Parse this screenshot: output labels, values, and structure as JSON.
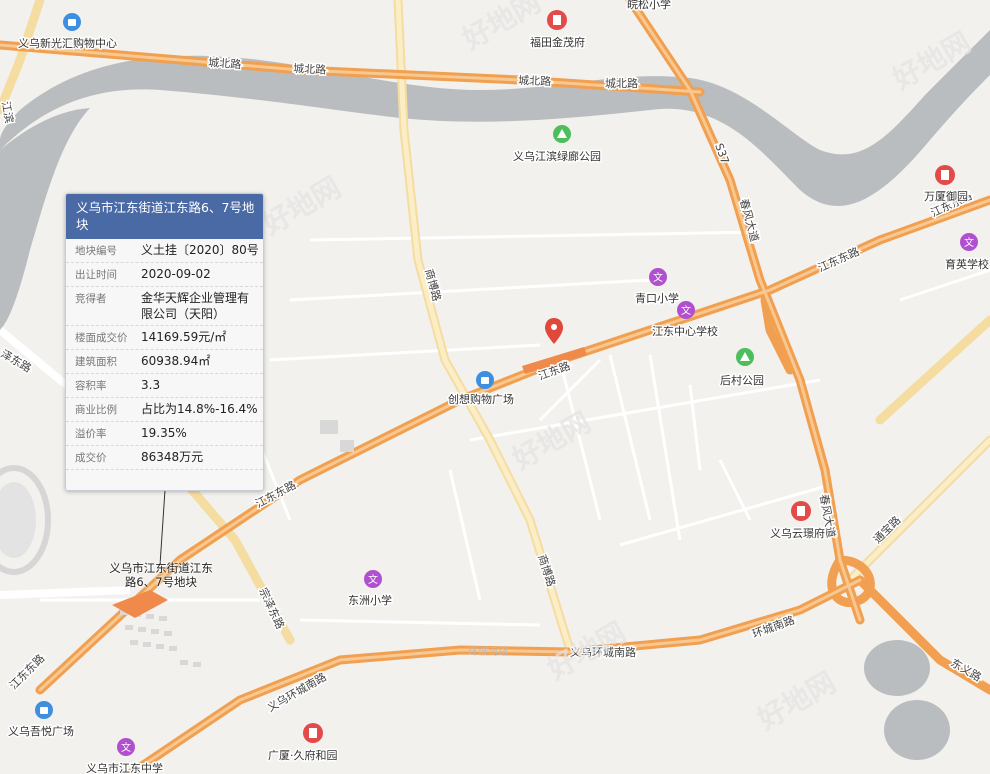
{
  "info_card": {
    "title": "义乌市江东街道江东路6、7号地块",
    "rows": [
      {
        "key": "地块编号",
        "value": "义土挂〔2020〕80号"
      },
      {
        "key": "出让时间",
        "value": "2020-09-02"
      },
      {
        "key": "竞得者",
        "value": "金华天辉企业管理有限公司（天阳）"
      },
      {
        "key": "楼面成交价",
        "value": "14169.59元/㎡"
      },
      {
        "key": "建筑面积",
        "value": "60938.94㎡"
      },
      {
        "key": "容积率",
        "value": "3.3"
      },
      {
        "key": "商业比例",
        "value": "占比为14.8%-16.4%"
      },
      {
        "key": "溢价率",
        "value": "19.35%"
      },
      {
        "key": "成交价",
        "value": "86348万元"
      }
    ]
  },
  "plot_label": "义乌市江东街道江东路6、7号地块",
  "roads": {
    "chengbei_1": "城北路",
    "chengbei_2": "城北路",
    "chengbei_3": "城北路",
    "chengbei_4": "城北路",
    "jiangdong_1": "江东东路",
    "jiangdong_2": "江东路",
    "jiangdong_3": "江东东路",
    "jiangdong_4": "江东东路",
    "shangbo_1": "商博路",
    "shangbo_2": "商博路",
    "zongze": "宗泽东路",
    "huancheng_1": "义乌环城南路",
    "huancheng_2": "环城南路",
    "huancheng_3": "义乌环城南路",
    "chunfeng_1": "春风大道",
    "chunfeng_2": "春风大道",
    "s37": "S37",
    "tongbao": "通宝路",
    "dongyi": "东义路",
    "jiangdong_east": "江东东路",
    "ze_left": "泽东路",
    "jiang_left": "江滨"
  },
  "pois": [
    {
      "name": "义乌新光汇购物中心",
      "icon": "shopping-icon",
      "color": "#3f8fe0"
    },
    {
      "name": "福田金茂府",
      "icon": "residence-icon",
      "color": "#e34a4a"
    },
    {
      "name": "皖松小学",
      "icon": "none",
      "color": ""
    },
    {
      "name": "义乌江滨绿廊公园",
      "icon": "park-icon",
      "color": "#4cbf5c"
    },
    {
      "name": "万厦御园",
      "icon": "residence-icon",
      "color": "#e34a4a"
    },
    {
      "name": "育英学校",
      "icon": "school-icon",
      "color": "#b050d0"
    },
    {
      "name": "青口小学",
      "icon": "school-icon",
      "color": "#b050d0"
    },
    {
      "name": "江东中心学校",
      "icon": "school-icon",
      "color": "#b050d0"
    },
    {
      "name": "后村公园",
      "icon": "park-icon",
      "color": "#4cbf5c"
    },
    {
      "name": "创想购物广场",
      "icon": "shopping-icon",
      "color": "#3f8fe0"
    },
    {
      "name": "义乌云璟府",
      "icon": "residence-icon",
      "color": "#e34a4a"
    },
    {
      "name": "东洲小学",
      "icon": "school-icon",
      "color": "#b050d0"
    },
    {
      "name": "义乌吾悦广场",
      "icon": "shopping-icon",
      "color": "#3f8fe0"
    },
    {
      "name": "广厦·久府和园",
      "icon": "residence-icon",
      "color": "#e34a4a"
    },
    {
      "name": "义乌市江东中学",
      "icon": "school-icon",
      "color": "#b050d0"
    }
  ],
  "school_glyph": "文",
  "faint_label": "环城南路",
  "watermark": "好地网",
  "colors": {
    "background": "#f3f1ed",
    "river": "#b9bcbf",
    "major_road": "#f4a95a",
    "secondary_road": "#f7e3a6",
    "plot": "#f08a4b",
    "pin": "#e0483b",
    "card_header": "#4a6aa5"
  }
}
